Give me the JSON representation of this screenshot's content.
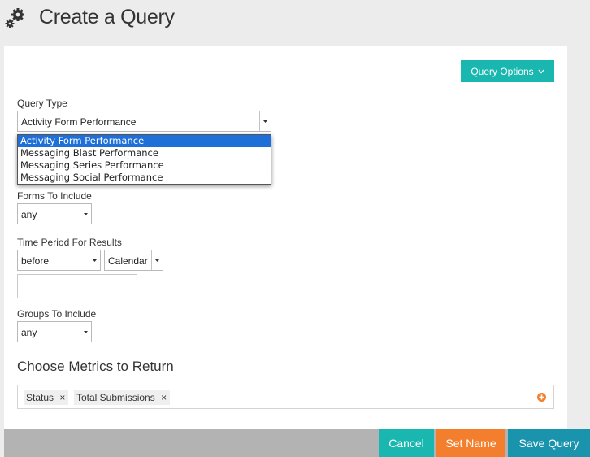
{
  "header": {
    "title": "Create a Query",
    "icon": "gears-icon"
  },
  "toolbar": {
    "query_options_label": "Query Options"
  },
  "query_type": {
    "label": "Query Type",
    "selected": "Activity Form Performance",
    "options": [
      "Activity Form Performance",
      "Messaging Blast Performance",
      "Messaging Series Performance",
      "Messaging Social Performance"
    ],
    "highlighted_index": 0
  },
  "forms": {
    "label": "Forms To Include",
    "selected": "any"
  },
  "time_period": {
    "label": "Time Period For Results",
    "comparison": "before",
    "calendar": "Calendar",
    "date_value": ""
  },
  "groups": {
    "label": "Groups To Include",
    "selected": "any"
  },
  "metrics": {
    "title": "Choose Metrics to Return",
    "tags": [
      "Status",
      "Total Submissions"
    ],
    "remove_glyph": "×"
  },
  "footer": {
    "cancel_label": "Cancel",
    "set_name_label": "Set Name",
    "save_label": "Save Query"
  },
  "colors": {
    "teal": "#1ab7b0",
    "orange": "#f37f2e",
    "save_blue": "#1a93ad",
    "highlight": "#1f6fd9",
    "footer_gray": "#b3b3b3",
    "background": "#ececec"
  }
}
